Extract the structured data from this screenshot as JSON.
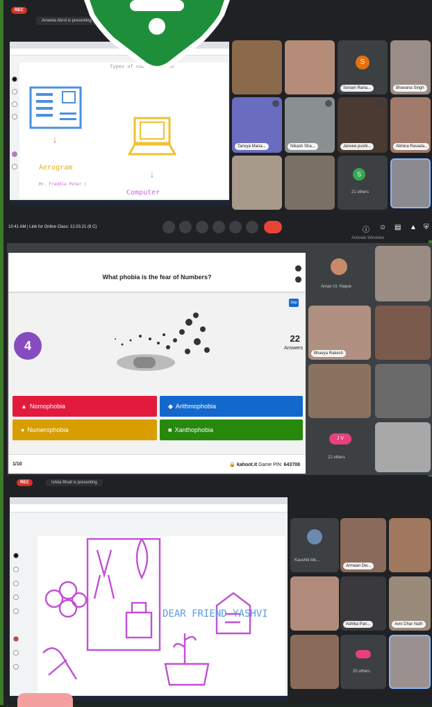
{
  "panel1": {
    "rec": "REC",
    "presenting": "Ameeta Abrol is presenting",
    "slide_title": "Types of communication",
    "label_left": "Aerogram",
    "label_left_sub": "Mr. Freddie Peter |",
    "label_right": "Computer",
    "meeting": "10:41 AM | Link for Online Class: 12.03.21 (8 C)",
    "activate": "Activate Windows",
    "tiles": [
      "",
      "",
      "Sonam Rana...",
      "Bhavana Singh",
      "Tanvya Mana...",
      "Nikash Sha...",
      "Janvee pushi...",
      "Abhina Ravada...",
      "",
      "",
      "21 others",
      ""
    ],
    "avatar_letter": "S",
    "others_letter": "S"
  },
  "panel2": {
    "question": "What phobia is the fear of Numbers?",
    "timer": "4",
    "answers_count": "22",
    "answers_label": "Answers",
    "options": [
      "Nomophobia",
      "Arithmophobia",
      "Numerophobia",
      "Xanthophobia"
    ],
    "progress": "1/10",
    "brand": "kahoot.it",
    "game_pin_label": "Game PIN:",
    "game_pin": "643708",
    "skip": "Skip",
    "tiles": [
      "Aman Ul. Haque",
      "",
      "Bhavya Rakesh",
      "",
      "",
      "",
      "22 others",
      ""
    ],
    "avatar_letters": "J V"
  },
  "panel3": {
    "rec": "REC",
    "presenting": "Ishita Bhatt is presenting",
    "slide_text": "DEAR FRIEND YASHVI",
    "tiles": [
      "Kaushik Me...",
      "Armaan Dw...",
      "",
      "",
      "Ashika Pan...",
      "Avni Dhar Nath",
      "",
      "20 others",
      ""
    ]
  },
  "colors": {
    "red": "#e21b3c",
    "blue": "#1368ce",
    "yellow": "#d89e00",
    "green": "#26890c",
    "kahoot_purple": "#864cbf",
    "accent_green": "#1d8f3a"
  }
}
